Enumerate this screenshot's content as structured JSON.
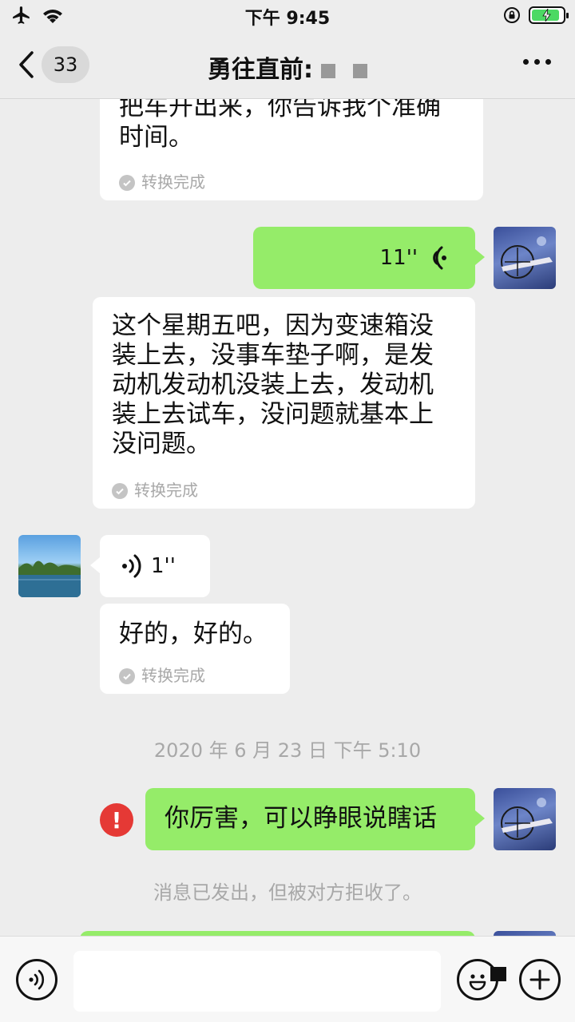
{
  "status_bar": {
    "time": "下午 9:45"
  },
  "nav": {
    "back_count": "33",
    "title": "勇往直前:"
  },
  "messages": {
    "m1": {
      "text_line1": "把车开出来，你告诉我个准确",
      "text_line2": "时间。",
      "status": "转换完成"
    },
    "m2": {
      "duration": "11''"
    },
    "m3": {
      "text_lines": [
        "这个星期五吧，因为变速箱没",
        "装上去，没事车垫子啊，是发",
        "动机发动机没装上去，发动机",
        "装上去试车，没问题就基本上",
        "没问题。"
      ],
      "status": "转换完成"
    },
    "m4": {
      "duration": "1''"
    },
    "m5": {
      "text": "好的，好的。",
      "status": "转换完成"
    },
    "timestamp": "2020 年 6 月 23 日  下午 5:10",
    "m6": {
      "text": "你厉害，可以睁眼说瞎话",
      "error_mark": "!"
    },
    "system_note": "消息已发出，但被对方拒收了。"
  },
  "input_bar": {
    "value": ""
  },
  "colors": {
    "background": "#ededed",
    "bubble_white": "#ffffff",
    "bubble_green": "#95ec69",
    "error_red": "#e53935",
    "muted_text": "#a8a8a8"
  }
}
